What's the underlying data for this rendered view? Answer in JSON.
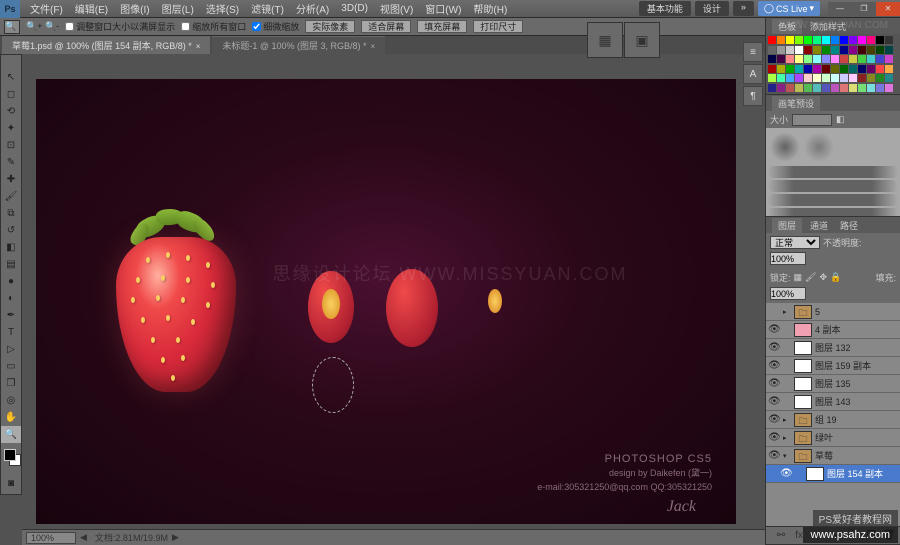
{
  "menubar": {
    "logo": "Ps",
    "items": [
      "文件(F)",
      "编辑(E)",
      "图像(I)",
      "图层(L)",
      "选择(S)",
      "滤镜(T)",
      "分析(A)",
      "3D(D)",
      "视图(V)",
      "窗口(W)",
      "帮助(H)"
    ],
    "right": {
      "basic": "基本功能",
      "design": "设计",
      "cslive": "CS Live"
    }
  },
  "options": {
    "chk1": "调整窗口大小以满屏显示",
    "chk2": "缩放所有窗口",
    "chk3": "细微缩放",
    "btn1": "实际像素",
    "btn2": "适合屏幕",
    "btn3": "填充屏幕",
    "btn4": "打印尺寸"
  },
  "tabs": [
    {
      "label": "草莓1.psd @ 100% (图层 154 副本, RGB/8) *",
      "active": true
    },
    {
      "label": "未标题-1 @ 100% (图层 3, RGB/8) *",
      "active": false
    }
  ],
  "canvas": {
    "credit_title": "PHOTOSHOP CS5",
    "credit_design": "design by Daikefen (黛一)",
    "credit_email": "e-mail:305321250@qq.com QQ:305321250",
    "signature": "Jack"
  },
  "statusbar": {
    "zoom": "100%",
    "info": "文档:2.81M/19.9M"
  },
  "panel_color": {
    "tab1": "色板",
    "tab2": "添加样式"
  },
  "panel_brush": {
    "tab": "画笔预设",
    "size_label": "大小"
  },
  "panel_layer": {
    "tabs": [
      "图层",
      "通道",
      "路径"
    ],
    "blend": "正常",
    "opacity_label": "不透明度:",
    "opacity": "100%",
    "lock_label": "锁定:",
    "fill_label": "填充:",
    "fill": "100%",
    "items": [
      {
        "name": "5",
        "eye": false,
        "folder": true
      },
      {
        "name": "4 副本",
        "eye": true,
        "pinkish": true
      },
      {
        "name": "图层 132",
        "eye": true
      },
      {
        "name": "图层 159 副本",
        "eye": true
      },
      {
        "name": "图层 135",
        "eye": true
      },
      {
        "name": "图层 143",
        "eye": true
      },
      {
        "name": "组 19",
        "eye": true,
        "folder": true
      },
      {
        "name": "绿叶",
        "eye": true,
        "folder": true
      },
      {
        "name": "草莓",
        "eye": true,
        "folder": true,
        "open": true
      },
      {
        "name": "图层 154 副本",
        "eye": true,
        "selected": true,
        "indent": true
      }
    ]
  },
  "watermarks": {
    "center": "思缘设计论坛  WWW.MISSYUAN.COM",
    "top_right": "WWW.MISSYUAN.COM",
    "bottom_right_1": "PS爱好者教程网",
    "bottom_right_2": "www.psahz.com"
  }
}
